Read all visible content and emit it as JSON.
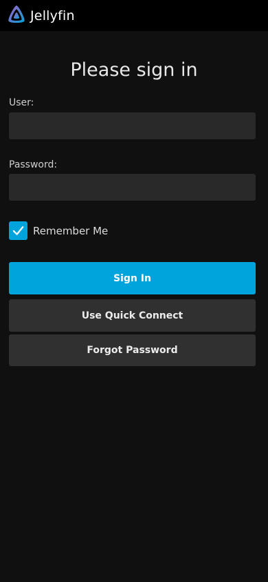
{
  "header": {
    "app_name": "Jellyfin",
    "logo_icon": "jellyfin-logo-icon"
  },
  "form": {
    "title": "Please sign in",
    "user_label": "User:",
    "user_value": "",
    "password_label": "Password:",
    "password_value": "",
    "remember_label": "Remember Me",
    "remember_checked": true
  },
  "buttons": {
    "sign_in": "Sign In",
    "quick_connect": "Use Quick Connect",
    "forgot_password": "Forgot Password"
  },
  "colors": {
    "accent": "#00a4dc",
    "background": "#101010",
    "header": "#000000",
    "input": "#292929",
    "secondary_button": "#303030"
  }
}
